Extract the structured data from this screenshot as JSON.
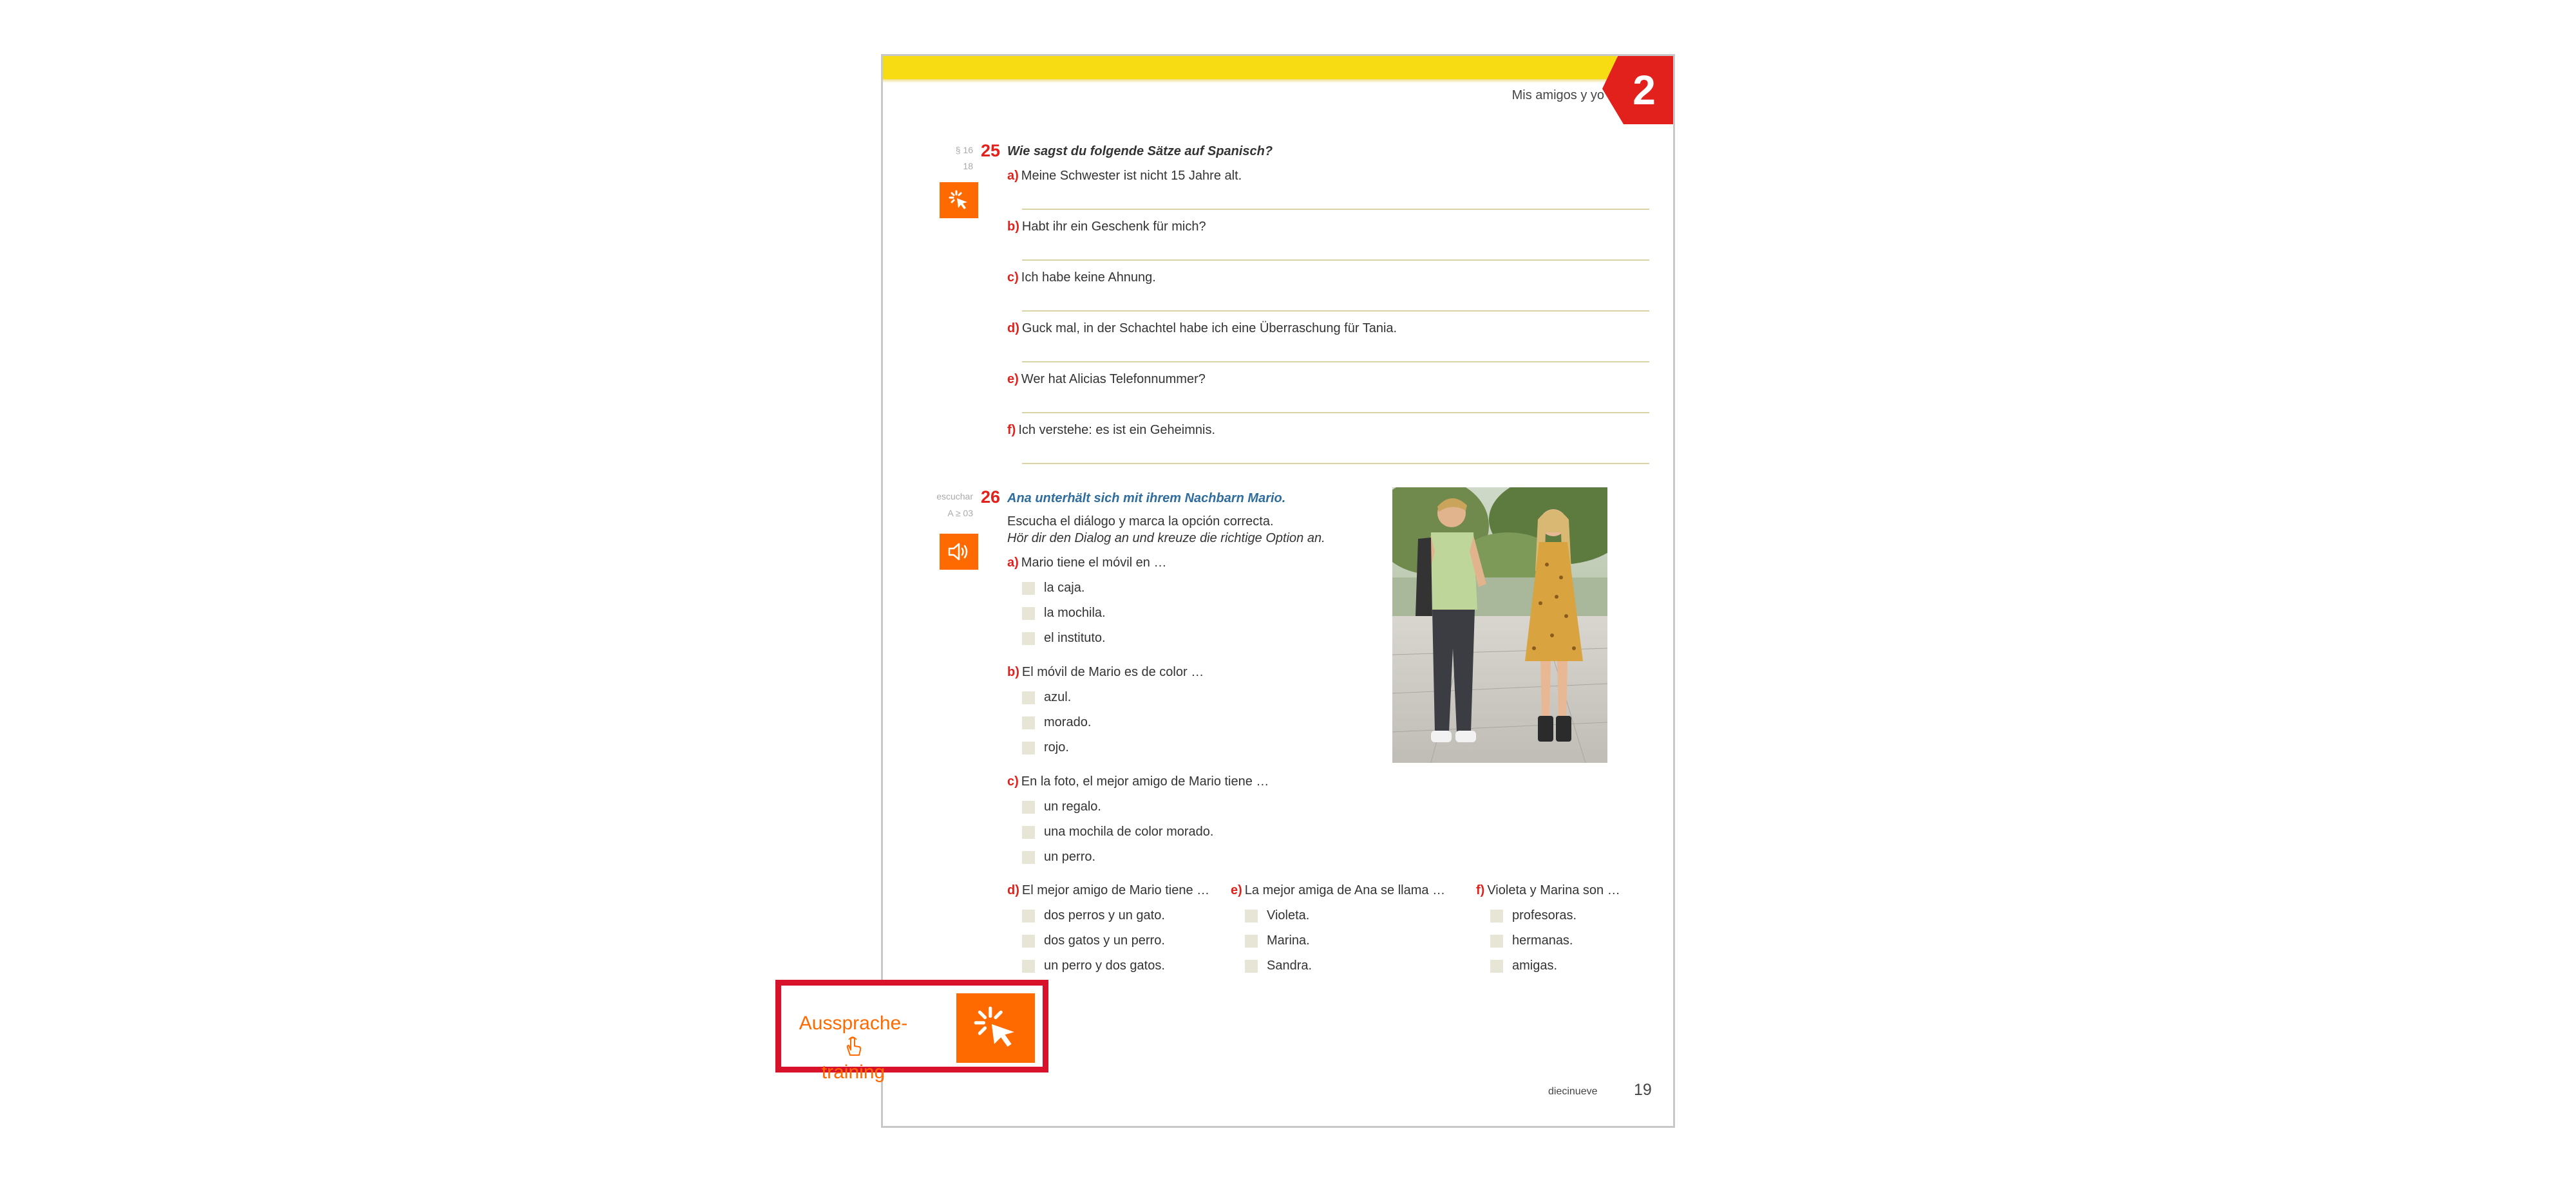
{
  "header": {
    "chapter_title": "Mis amigos y yo",
    "chapter_number": "2"
  },
  "exercise25": {
    "number": "25",
    "side_ref": "§ 16",
    "side_ref2": "18",
    "title": "Wie sagst du folgende Sätze auf Spanisch?",
    "items": [
      {
        "label": "a)",
        "text": "Meine Schwester ist nicht 15 Jahre alt."
      },
      {
        "label": "b)",
        "text": "Habt ihr ein Geschenk für mich?"
      },
      {
        "label": "c)",
        "text": "Ich habe keine Ahnung."
      },
      {
        "label": "d)",
        "text": "Guck mal, in der Schachtel habe ich eine Überraschung für Tania."
      },
      {
        "label": "e)",
        "text": "Wer hat Alicias Telefonnummer?"
      },
      {
        "label": "f)",
        "text": "Ich verstehe: es ist ein Geheimnis."
      }
    ]
  },
  "exercise26": {
    "number": "26",
    "side_label": "escuchar",
    "side_ref": "A ≥ 03",
    "title": "Ana unterhält sich mit ihrem Nachbarn Mario.",
    "instruction_es": "Escucha el diálogo y marca la opción correcta.",
    "instruction_de": "Hör dir den Dialog an und kreuze die richtige Option an.",
    "questions": [
      {
        "label": "a)",
        "text": "Mario tiene el móvil en …",
        "options": [
          "la caja.",
          "la mochila.",
          "el instituto."
        ]
      },
      {
        "label": "b)",
        "text": "El móvil de Mario es de color …",
        "options": [
          "azul.",
          "morado.",
          "rojo."
        ]
      },
      {
        "label": "c)",
        "text": "En la foto, el mejor amigo de Mario tiene …",
        "options": [
          "un regalo.",
          "una mochila de color morado.",
          "un perro."
        ]
      },
      {
        "label": "d)",
        "text": "El mejor amigo de Mario tiene …",
        "options": [
          "dos perros y un gato.",
          "dos gatos y un perro.",
          "un perro y dos gatos."
        ]
      },
      {
        "label": "e)",
        "text": "La mejor amiga de Ana se llama …",
        "options": [
          "Violeta.",
          "Marina.",
          "Sandra."
        ]
      },
      {
        "label": "f)",
        "text": "Violeta y Marina son …",
        "options": [
          "profesoras.",
          "hermanas.",
          "amigas."
        ]
      }
    ]
  },
  "footer": {
    "page_word": "diecinueve",
    "page_number": "19"
  },
  "pronunciation": {
    "label_line1": "Aussprache-",
    "label_line2": "training"
  },
  "colors": {
    "accent_red": "#e2211c",
    "orange": "#ff6a00",
    "yellow": "#f7dc14",
    "highlight_red": "#d8122b"
  },
  "icons": [
    "click-icon",
    "speaker-icon",
    "hand-tap-icon"
  ]
}
